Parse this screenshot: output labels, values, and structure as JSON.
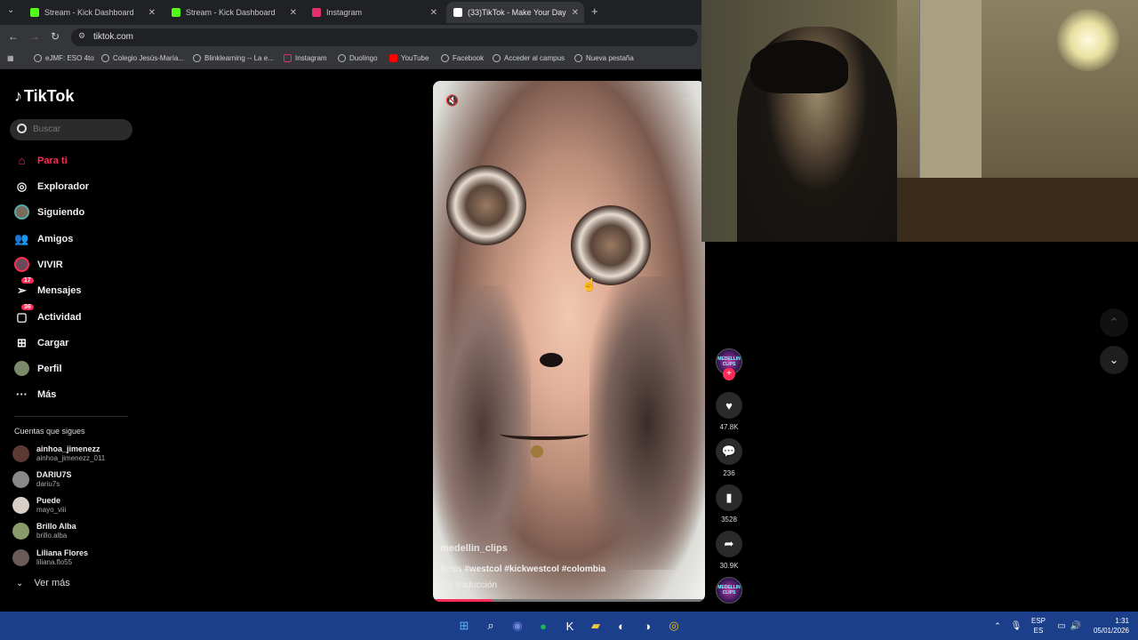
{
  "browser": {
    "tabs": [
      {
        "title": "Stream - Kick Dashboard",
        "color": "#53fc18"
      },
      {
        "title": "Stream - Kick Dashboard",
        "color": "#53fc18"
      },
      {
        "title": "Instagram",
        "color": "#e1306c"
      },
      {
        "title": "(33)TikTok - Make Your Day",
        "color": "#ffffff"
      }
    ],
    "url": "tiktok.com",
    "bookmarks": [
      "eJMF: ESO 4to",
      "Colegio Jesús-María...",
      "Blinklearning -- La e...",
      "Instagram",
      "Duolingo",
      "YouTube",
      "Facebook",
      "Acceder al campus",
      "Nueva pestaña"
    ]
  },
  "tiktok": {
    "logo": "TikTok",
    "search_placeholder": "Buscar",
    "nav": [
      {
        "label": "Para ti",
        "icon": "home-icon"
      },
      {
        "label": "Explorador",
        "icon": "compass-icon"
      },
      {
        "label": "Siguiendo",
        "icon": "following-avatar-icon"
      },
      {
        "label": "Amigos",
        "icon": "friends-icon"
      },
      {
        "label": "VIVIR",
        "icon": "live-icon"
      },
      {
        "label": "Mensajes",
        "icon": "messages-icon",
        "badge": "17"
      },
      {
        "label": "Actividad",
        "icon": "activity-icon",
        "badge": "36"
      },
      {
        "label": "Cargar",
        "icon": "upload-icon"
      },
      {
        "label": "Perfil",
        "icon": "profile-icon"
      },
      {
        "label": "Más",
        "icon": "more-icon"
      }
    ],
    "following_title": "Cuentas que sigues",
    "following": [
      {
        "name": "ainhoa_jimenezz",
        "handle": "ainhoa_jimenezz_011"
      },
      {
        "name": "DARIU7S",
        "handle": "dariu7s"
      },
      {
        "name": "Puede",
        "handle": "mayo_viii"
      },
      {
        "name": "Brillo Alba",
        "handle": "brillo.alba"
      },
      {
        "name": "Liliana Flores",
        "handle": "liliana.flo55"
      }
    ],
    "see_more": "Ver más",
    "video": {
      "author": "medellin_clips",
      "caption_text": "Besis",
      "caption_tags": "#westcol #kickwestcol #colombia",
      "translate": "Ver traducción",
      "progress_fraction": 0.22
    },
    "actions": {
      "likes": "47.8K",
      "comments": "236",
      "saves": "3528",
      "shares": "30.9K",
      "avatar_text": "MEDELLIN CLIPS"
    }
  },
  "taskbar": {
    "lang_top": "ESP",
    "lang_bottom": "ES",
    "time": "1:31",
    "date": "05/01/2026"
  }
}
